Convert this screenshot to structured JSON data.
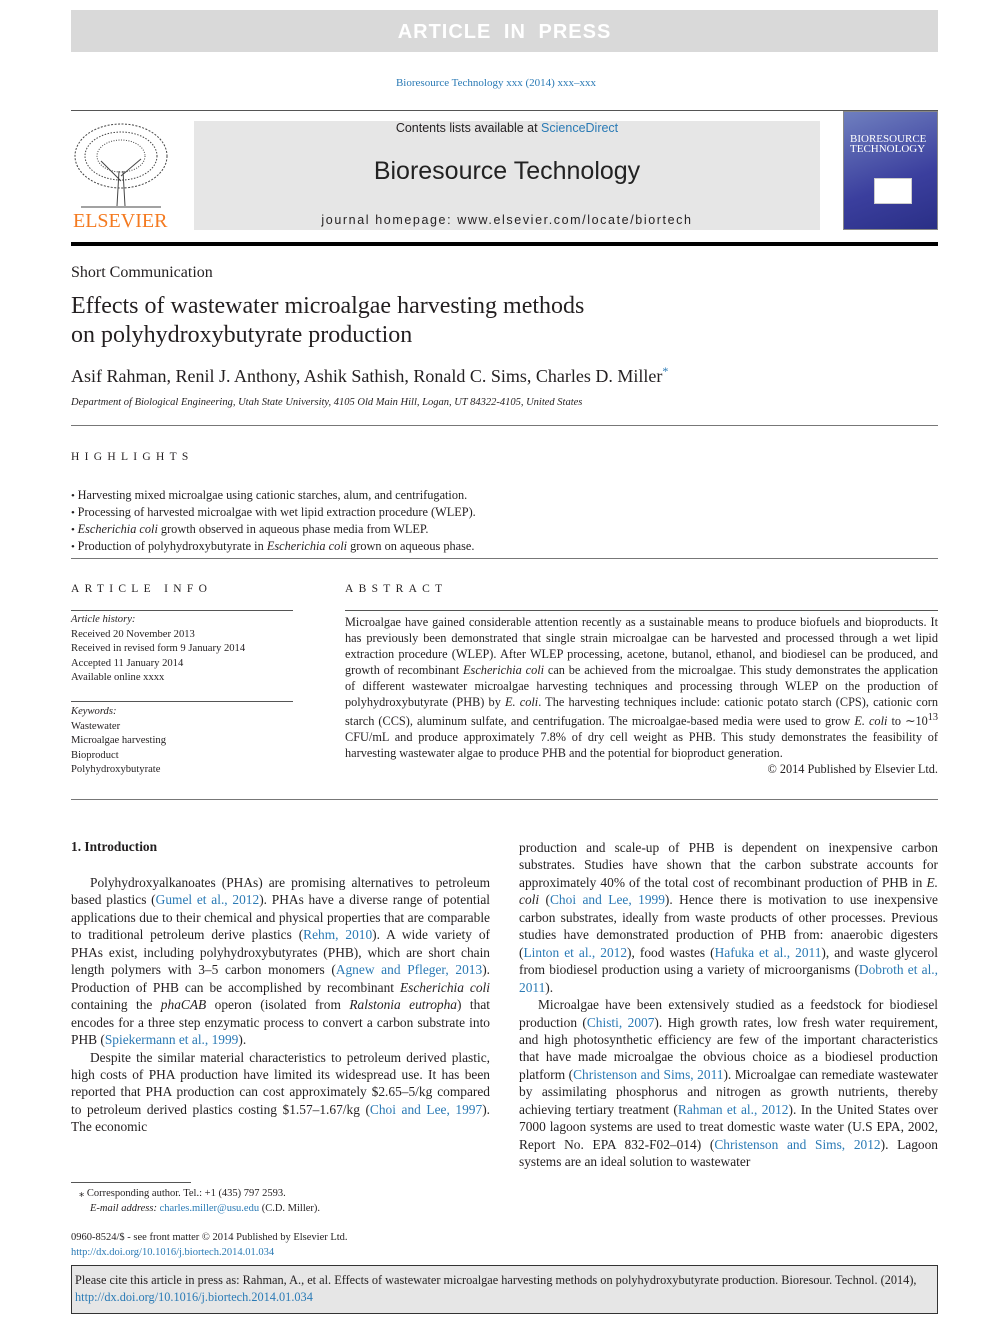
{
  "banner": "ARTICLE IN PRESS",
  "journal_ref": "Bioresource Technology xxx (2014) xxx–xxx",
  "header": {
    "contents_prefix": "Contents lists available at ",
    "contents_link": "ScienceDirect",
    "journal_title": "Bioresource Technology",
    "homepage": "journal homepage: www.elsevier.com/locate/biortech",
    "publisher_logo": "ELSEVIER",
    "cover_title": "BIORESOURCE TECHNOLOGY"
  },
  "article": {
    "type": "Short Communication",
    "title_line1": "Effects of wastewater microalgae harvesting methods",
    "title_line2": "on polyhydroxybutyrate production",
    "authors": "Asif Rahman, Renil J. Anthony, Ashik Sathish, Ronald C. Sims, Charles D. Miller",
    "corresponding_mark": "*",
    "affiliation": "Department of Biological Engineering, Utah State University, 4105 Old Main Hill, Logan, UT 84322-4105, United States"
  },
  "highlights": {
    "heading": "HIGHLIGHTS",
    "items": [
      [
        {
          "t": "Harvesting mixed microalgae using cationic starches, alum, and centrifugation."
        }
      ],
      [
        {
          "t": "Processing of harvested microalgae with wet lipid extraction procedure (WLEP)."
        }
      ],
      [
        {
          "t": "Escherichia coli",
          "s": "i"
        },
        {
          "t": " growth observed in aqueous phase media from WLEP."
        }
      ],
      [
        {
          "t": "Production of polyhydroxybutyrate in "
        },
        {
          "t": "Escherichia coli",
          "s": "i"
        },
        {
          "t": " grown on aqueous phase."
        }
      ]
    ]
  },
  "article_info": {
    "heading": "ARTICLE INFO",
    "history_label": "Article history:",
    "history": [
      "Received 20 November 2013",
      "Received in revised form 9 January 2014",
      "Accepted 11 January 2014",
      "Available online xxxx"
    ],
    "keywords_label": "Keywords:",
    "keywords": [
      "Wastewater",
      "Microalgae harvesting",
      "Bioproduct",
      "Polyhydroxybutyrate"
    ]
  },
  "abstract": {
    "heading": "ABSTRACT",
    "body": [
      {
        "t": "Microalgae have gained considerable attention recently as a sustainable means to produce biofuels and bioproducts. It has previously been demonstrated that single strain microalgae can be harvested and processed through a wet lipid extraction procedure (WLEP). After WLEP processing, acetone, butanol, ethanol, and biodiesel can be produced, and growth of recombinant "
      },
      {
        "t": "Escherichia coli",
        "s": "i"
      },
      {
        "t": " can be achieved from the microalgae. This study demonstrates the application of different wastewater microalgae harvesting techniques and processing through WLEP on the production of polyhydroxybutyrate (PHB) by "
      },
      {
        "t": "E. coli",
        "s": "i"
      },
      {
        "t": ". The harvesting techniques include: cationic potato starch (CPS), cationic corn starch (CCS), aluminum sulfate, and centrifugation. The microalgae-based media were used to grow "
      },
      {
        "t": "E. coli",
        "s": "i"
      },
      {
        "t": " to ∼10"
      },
      {
        "t": "13",
        "s": "sup"
      },
      {
        "t": " CFU/mL and produce approximately 7.8% of dry cell weight as PHB. This study demonstrates the feasibility of harvesting wastewater algae to produce PHB and the potential for bioproduct generation."
      }
    ],
    "copyright": "© 2014 Published by Elsevier Ltd."
  },
  "intro": {
    "heading": "1. Introduction",
    "left": [
      [
        {
          "t": "Polyhydroxyalkanoates (PHAs) are promising alternatives to petroleum based plastics ("
        },
        {
          "t": "Gumel et al., 2012",
          "s": "a"
        },
        {
          "t": "). PHAs have a diverse range of potential applications due to their chemical and physical properties that are comparable to traditional petroleum derive plastics ("
        },
        {
          "t": "Rehm, 2010",
          "s": "a"
        },
        {
          "t": "). A wide variety of PHAs exist, including polyhydroxybutyrates (PHB), which are short chain length polymers with 3–5 carbon monomers ("
        },
        {
          "t": "Agnew and Pfleger, 2013",
          "s": "a"
        },
        {
          "t": "). Production of PHB can be accomplished by recombinant "
        },
        {
          "t": "Escherichia coli",
          "s": "i"
        },
        {
          "t": " containing the "
        },
        {
          "t": "phaCAB",
          "s": "i"
        },
        {
          "t": " operon (isolated from "
        },
        {
          "t": "Ralstonia eutropha",
          "s": "i"
        },
        {
          "t": ") that encodes for a three step enzymatic process to convert a carbon substrate into PHB ("
        },
        {
          "t": "Spiekermann et al., 1999",
          "s": "a"
        },
        {
          "t": ")."
        }
      ],
      [
        {
          "t": "Despite the similar material characteristics to petroleum derived plastic, high costs of PHA production have limited its widespread use. It has been reported that PHA production can cost approximately $2.65–5/kg compared to petroleum derived plastics costing $1.57–1.67/kg ("
        },
        {
          "t": "Choi and Lee, 1997",
          "s": "a"
        },
        {
          "t": "). The economic"
        }
      ]
    ],
    "right": [
      [
        {
          "t": "production and scale-up of PHB is dependent on inexpensive carbon substrates. Studies have shown that the carbon substrate accounts for approximately 40% of the total cost of recombinant production of PHB in "
        },
        {
          "t": "E. coli",
          "s": "i"
        },
        {
          "t": " ("
        },
        {
          "t": "Choi and Lee, 1999",
          "s": "a"
        },
        {
          "t": "). Hence there is motivation to use inexpensive carbon substrates, ideally from waste products of other processes. Previous studies have demonstrated production of PHB from: anaerobic digesters ("
        },
        {
          "t": "Linton et al., 2012",
          "s": "a"
        },
        {
          "t": "), food wastes ("
        },
        {
          "t": "Hafuka et al., 2011",
          "s": "a"
        },
        {
          "t": "), and waste glycerol from biodiesel production using a variety of microorganisms ("
        },
        {
          "t": "Dobroth et al., 2011",
          "s": "a"
        },
        {
          "t": ")."
        }
      ],
      [
        {
          "t": "Microalgae have been extensively studied as a feedstock for biodiesel production ("
        },
        {
          "t": "Chisti, 2007",
          "s": "a"
        },
        {
          "t": "). High growth rates, low fresh water requirement, and high photosynthetic efficiency are few of the important characteristics that have made microalgae the obvious choice as a biodiesel production platform ("
        },
        {
          "t": "Christenson and Sims, 2011",
          "s": "a"
        },
        {
          "t": "). Microalgae can remediate wastewater by assimilating phosphorus and nitrogen as growth nutrients, thereby achieving tertiary treatment ("
        },
        {
          "t": "Rahman et al., 2012",
          "s": "a"
        },
        {
          "t": "). In the United States over 7000 lagoon systems are used to treat domestic waste water (U.S EPA, 2002, Report No. EPA 832-F02–014) ("
        },
        {
          "t": "Christenson and Sims, 2012",
          "s": "a"
        },
        {
          "t": "). Lagoon systems are an ideal solution to wastewater"
        }
      ]
    ]
  },
  "footnote": {
    "corresponding": "⁎ Corresponding author. Tel.: +1 (435) 797 2593.",
    "email_label": "E-mail address: ",
    "email": "charles.miller@usu.edu",
    "email_suffix": " (C.D. Miller)."
  },
  "issn": "0960-8524/$ - see front matter © 2014 Published by Elsevier Ltd.",
  "doi": "http://dx.doi.org/10.1016/j.biortech.2014.01.034",
  "citation": {
    "text": "Please cite this article in press as: Rahman, A., et al. Effects of wastewater microalgae harvesting methods on polyhydroxybutyrate production. Bioresour. Technol. (2014), ",
    "link": "http://dx.doi.org/10.1016/j.biortech.2014.01.034"
  }
}
